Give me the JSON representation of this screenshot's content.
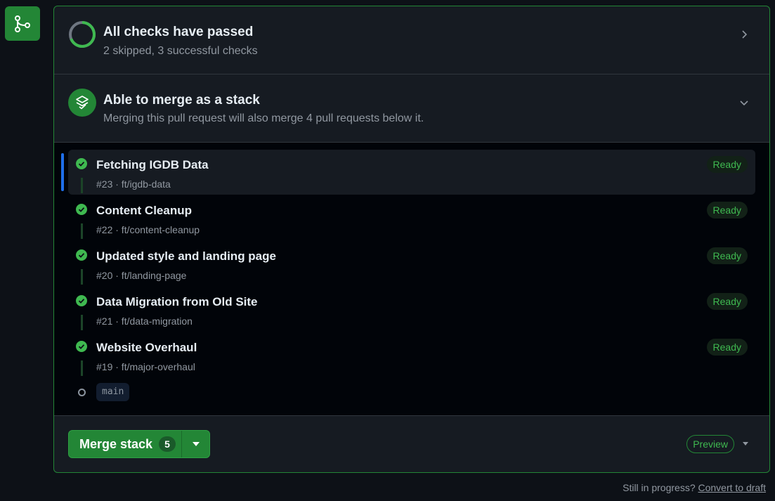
{
  "sidebar": {
    "icon": "git-merge-icon",
    "color": "#238636"
  },
  "checks": {
    "title": "All checks have passed",
    "subtitle": "2 skipped, 3 successful checks",
    "icon": "status-ring-icon"
  },
  "stack": {
    "title": "Able to merge as a stack",
    "subtitle": "Merging this pull request will also merge 4 pull requests below it.",
    "icon": "stack-icon"
  },
  "pull_requests": [
    {
      "title": "Fetching IGDB Data",
      "meta": "#23 · ft/igdb-data",
      "status": "Ready"
    },
    {
      "title": "Content Cleanup",
      "meta": "#22 · ft/content-cleanup",
      "status": "Ready"
    },
    {
      "title": "Updated style and landing page",
      "meta": "#20 · ft/landing-page",
      "status": "Ready"
    },
    {
      "title": "Data Migration from Old Site",
      "meta": "#21 · ft/data-migration",
      "status": "Ready"
    },
    {
      "title": "Website Overhaul",
      "meta": "#19 · ft/major-overhaul",
      "status": "Ready"
    }
  ],
  "base_branch": "main",
  "merge": {
    "label": "Merge stack",
    "count": "5",
    "preview_label": "Preview"
  },
  "footer": {
    "text": "Still in progress?",
    "link": "Convert to draft"
  },
  "colors": {
    "accent": "#238636",
    "success": "#3fb950",
    "active_bar": "#1f6feb"
  }
}
